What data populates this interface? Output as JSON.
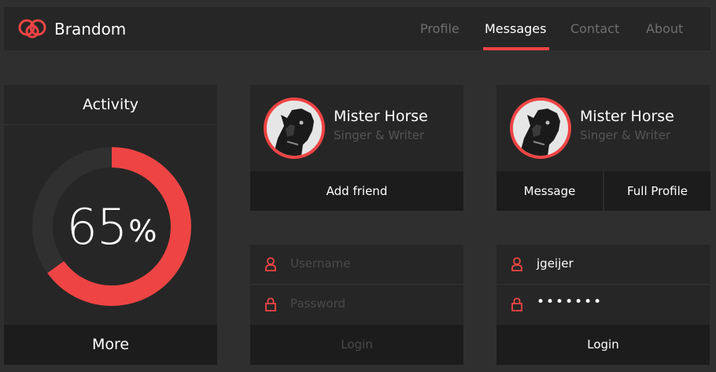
{
  "brand": {
    "name": "Brandom",
    "accent": "#ef4444"
  },
  "nav": {
    "items": [
      {
        "label": "Profile",
        "active": false
      },
      {
        "label": "Messages",
        "active": true
      },
      {
        "label": "Contact",
        "active": false
      },
      {
        "label": "About",
        "active": false
      }
    ]
  },
  "activity": {
    "title": "Activity",
    "value": "65",
    "unit": "%",
    "progress_fraction": 0.65,
    "button_label": "More"
  },
  "profile_card_1": {
    "name": "Mister Horse",
    "subtitle": "Singer & Writer",
    "button_label": "Add friend"
  },
  "profile_card_2": {
    "name": "Mister Horse",
    "subtitle": "Singer & Writer",
    "message_label": "Message",
    "full_profile_label": "Full Profile"
  },
  "login_form_1": {
    "username_placeholder": "Username",
    "password_placeholder": "Password",
    "login_label": "Login"
  },
  "login_form_2": {
    "username_value": "jgeijer",
    "password_value": "•••••••",
    "login_label": "Login"
  }
}
